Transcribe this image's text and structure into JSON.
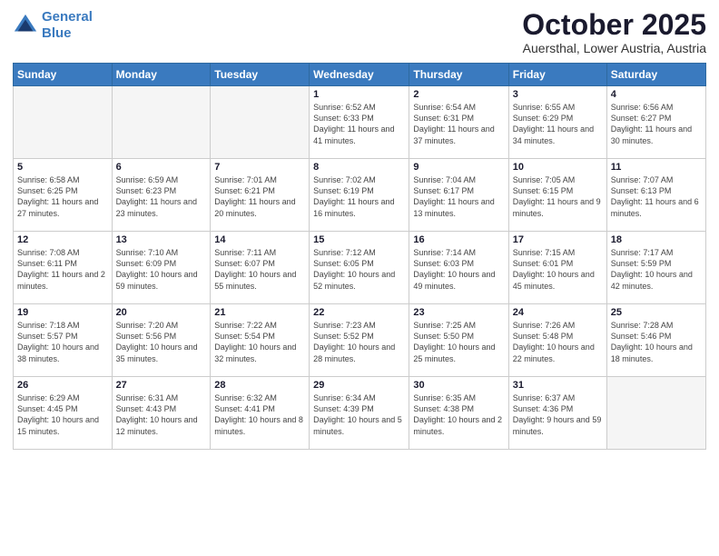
{
  "header": {
    "logo_line1": "General",
    "logo_line2": "Blue",
    "month": "October 2025",
    "location": "Auersthal, Lower Austria, Austria"
  },
  "weekdays": [
    "Sunday",
    "Monday",
    "Tuesday",
    "Wednesday",
    "Thursday",
    "Friday",
    "Saturday"
  ],
  "weeks": [
    [
      {
        "day": "",
        "info": "",
        "empty": true
      },
      {
        "day": "",
        "info": "",
        "empty": true
      },
      {
        "day": "",
        "info": "",
        "empty": true
      },
      {
        "day": "1",
        "info": "Sunrise: 6:52 AM\nSunset: 6:33 PM\nDaylight: 11 hours\nand 41 minutes.",
        "empty": false
      },
      {
        "day": "2",
        "info": "Sunrise: 6:54 AM\nSunset: 6:31 PM\nDaylight: 11 hours\nand 37 minutes.",
        "empty": false
      },
      {
        "day": "3",
        "info": "Sunrise: 6:55 AM\nSunset: 6:29 PM\nDaylight: 11 hours\nand 34 minutes.",
        "empty": false
      },
      {
        "day": "4",
        "info": "Sunrise: 6:56 AM\nSunset: 6:27 PM\nDaylight: 11 hours\nand 30 minutes.",
        "empty": false
      }
    ],
    [
      {
        "day": "5",
        "info": "Sunrise: 6:58 AM\nSunset: 6:25 PM\nDaylight: 11 hours\nand 27 minutes.",
        "empty": false
      },
      {
        "day": "6",
        "info": "Sunrise: 6:59 AM\nSunset: 6:23 PM\nDaylight: 11 hours\nand 23 minutes.",
        "empty": false
      },
      {
        "day": "7",
        "info": "Sunrise: 7:01 AM\nSunset: 6:21 PM\nDaylight: 11 hours\nand 20 minutes.",
        "empty": false
      },
      {
        "day": "8",
        "info": "Sunrise: 7:02 AM\nSunset: 6:19 PM\nDaylight: 11 hours\nand 16 minutes.",
        "empty": false
      },
      {
        "day": "9",
        "info": "Sunrise: 7:04 AM\nSunset: 6:17 PM\nDaylight: 11 hours\nand 13 minutes.",
        "empty": false
      },
      {
        "day": "10",
        "info": "Sunrise: 7:05 AM\nSunset: 6:15 PM\nDaylight: 11 hours\nand 9 minutes.",
        "empty": false
      },
      {
        "day": "11",
        "info": "Sunrise: 7:07 AM\nSunset: 6:13 PM\nDaylight: 11 hours\nand 6 minutes.",
        "empty": false
      }
    ],
    [
      {
        "day": "12",
        "info": "Sunrise: 7:08 AM\nSunset: 6:11 PM\nDaylight: 11 hours\nand 2 minutes.",
        "empty": false
      },
      {
        "day": "13",
        "info": "Sunrise: 7:10 AM\nSunset: 6:09 PM\nDaylight: 10 hours\nand 59 minutes.",
        "empty": false
      },
      {
        "day": "14",
        "info": "Sunrise: 7:11 AM\nSunset: 6:07 PM\nDaylight: 10 hours\nand 55 minutes.",
        "empty": false
      },
      {
        "day": "15",
        "info": "Sunrise: 7:12 AM\nSunset: 6:05 PM\nDaylight: 10 hours\nand 52 minutes.",
        "empty": false
      },
      {
        "day": "16",
        "info": "Sunrise: 7:14 AM\nSunset: 6:03 PM\nDaylight: 10 hours\nand 49 minutes.",
        "empty": false
      },
      {
        "day": "17",
        "info": "Sunrise: 7:15 AM\nSunset: 6:01 PM\nDaylight: 10 hours\nand 45 minutes.",
        "empty": false
      },
      {
        "day": "18",
        "info": "Sunrise: 7:17 AM\nSunset: 5:59 PM\nDaylight: 10 hours\nand 42 minutes.",
        "empty": false
      }
    ],
    [
      {
        "day": "19",
        "info": "Sunrise: 7:18 AM\nSunset: 5:57 PM\nDaylight: 10 hours\nand 38 minutes.",
        "empty": false
      },
      {
        "day": "20",
        "info": "Sunrise: 7:20 AM\nSunset: 5:56 PM\nDaylight: 10 hours\nand 35 minutes.",
        "empty": false
      },
      {
        "day": "21",
        "info": "Sunrise: 7:22 AM\nSunset: 5:54 PM\nDaylight: 10 hours\nand 32 minutes.",
        "empty": false
      },
      {
        "day": "22",
        "info": "Sunrise: 7:23 AM\nSunset: 5:52 PM\nDaylight: 10 hours\nand 28 minutes.",
        "empty": false
      },
      {
        "day": "23",
        "info": "Sunrise: 7:25 AM\nSunset: 5:50 PM\nDaylight: 10 hours\nand 25 minutes.",
        "empty": false
      },
      {
        "day": "24",
        "info": "Sunrise: 7:26 AM\nSunset: 5:48 PM\nDaylight: 10 hours\nand 22 minutes.",
        "empty": false
      },
      {
        "day": "25",
        "info": "Sunrise: 7:28 AM\nSunset: 5:46 PM\nDaylight: 10 hours\nand 18 minutes.",
        "empty": false
      }
    ],
    [
      {
        "day": "26",
        "info": "Sunrise: 6:29 AM\nSunset: 4:45 PM\nDaylight: 10 hours\nand 15 minutes.",
        "empty": false
      },
      {
        "day": "27",
        "info": "Sunrise: 6:31 AM\nSunset: 4:43 PM\nDaylight: 10 hours\nand 12 minutes.",
        "empty": false
      },
      {
        "day": "28",
        "info": "Sunrise: 6:32 AM\nSunset: 4:41 PM\nDaylight: 10 hours\nand 8 minutes.",
        "empty": false
      },
      {
        "day": "29",
        "info": "Sunrise: 6:34 AM\nSunset: 4:39 PM\nDaylight: 10 hours\nand 5 minutes.",
        "empty": false
      },
      {
        "day": "30",
        "info": "Sunrise: 6:35 AM\nSunset: 4:38 PM\nDaylight: 10 hours\nand 2 minutes.",
        "empty": false
      },
      {
        "day": "31",
        "info": "Sunrise: 6:37 AM\nSunset: 4:36 PM\nDaylight: 9 hours\nand 59 minutes.",
        "empty": false
      },
      {
        "day": "",
        "info": "",
        "empty": true
      }
    ]
  ]
}
